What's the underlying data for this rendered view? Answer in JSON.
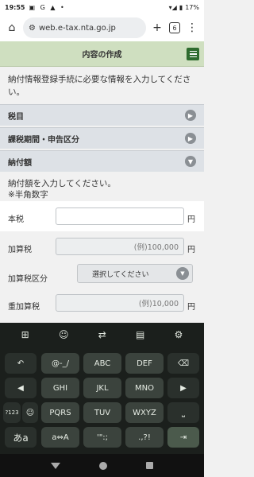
{
  "status": {
    "time": "19:55",
    "left_icons": "▣ G ▲ •",
    "battery": "17%"
  },
  "browser": {
    "url": "web.e-tax.nta.go.jp",
    "tab_count": "6"
  },
  "page": {
    "title": "内容の作成",
    "intro": "納付情報登録手続に必要な情報を入力してください。",
    "sections": [
      {
        "label": "税目"
      },
      {
        "label": "課税期間・申告区分"
      },
      {
        "label": "納付額"
      }
    ],
    "instruction_line1": "納付額を入力してください。",
    "instruction_line2": "※半角数字",
    "fields": {
      "honzei": {
        "label": "本税",
        "value": "",
        "unit": "円"
      },
      "kasanzei": {
        "label": "加算税",
        "placeholder": "(例)100,000",
        "unit": "円"
      },
      "kasanzei_kubun": {
        "label": "加算税区分",
        "select": "選択してください"
      },
      "juukasanzei": {
        "label": "重加算税",
        "placeholder": "(例)10,000",
        "unit": "円"
      }
    }
  },
  "keyboard": {
    "rows": [
      [
        "↶",
        "@-_/",
        "ABC",
        "DEF",
        "⌫"
      ],
      [
        "◀",
        "GHI",
        "JKL",
        "MNO",
        "▶"
      ],
      [
        "?123",
        "☺",
        "PQRS",
        "TUV",
        "WXYZ",
        "⎵"
      ],
      [
        "あa",
        "a⇔A",
        "'\":;",
        ".,?!",
        "⇥"
      ]
    ]
  }
}
